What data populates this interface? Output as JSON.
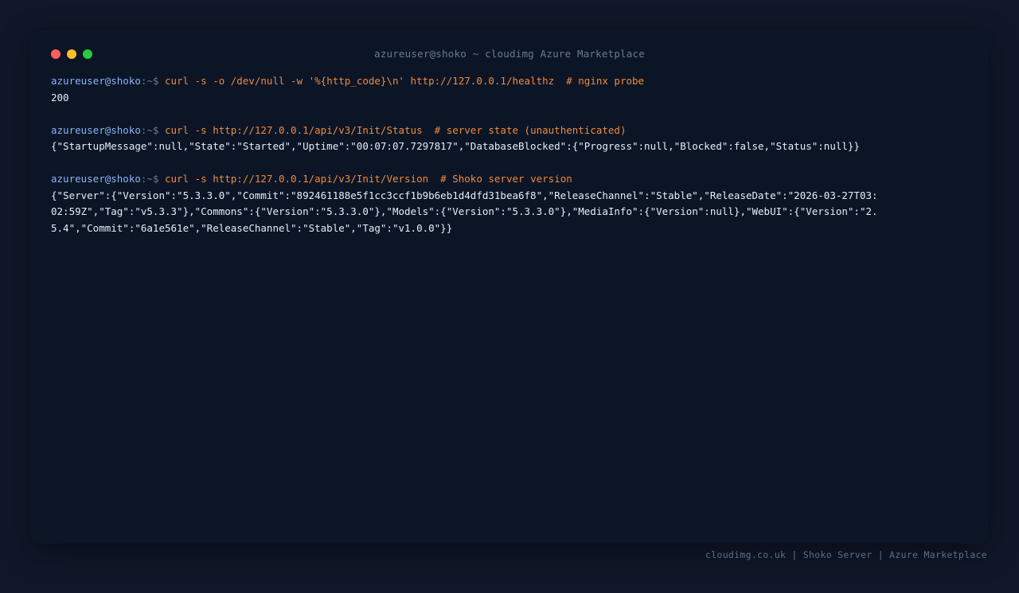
{
  "window": {
    "title": "azureuser@shoko ~ cloudimg Azure Marketplace"
  },
  "prompt": {
    "user": "azureuser@shoko",
    "path": ":~$ "
  },
  "blocks": [
    {
      "command": "curl -s -o /dev/null -w '%{http_code}\\n' http://127.0.0.1/healthz  # nginx probe",
      "output": "200"
    },
    {
      "command": "curl -s http://127.0.0.1/api/v3/Init/Status  # server state (unauthenticated)",
      "output": "{\"StartupMessage\":null,\"State\":\"Started\",\"Uptime\":\"00:07:07.7297817\",\"DatabaseBlocked\":{\"Progress\":null,\"Blocked\":false,\"Status\":null}}"
    },
    {
      "command": "curl -s http://127.0.0.1/api/v3/Init/Version  # Shoko server version",
      "output": "{\"Server\":{\"Version\":\"5.3.3.0\",\"Commit\":\"892461188e5f1cc3ccf1b9b6eb1d4dfd31bea6f8\",\"ReleaseChannel\":\"Stable\",\"ReleaseDate\":\"2026-03-27T03:02:59Z\",\"Tag\":\"v5.3.3\"},\"Commons\":{\"Version\":\"5.3.3.0\"},\"Models\":{\"Version\":\"5.3.3.0\"},\"MediaInfo\":{\"Version\":null},\"WebUI\":{\"Version\":\"2.5.4\",\"Commit\":\"6a1e561e\",\"ReleaseChannel\":\"Stable\",\"Tag\":\"v1.0.0\"}}"
    }
  ],
  "footer": {
    "text": "cloudimg.co.uk | Shoko Server | Azure Marketplace"
  },
  "colors": {
    "background": "#0f1729",
    "window": "#0b1526",
    "prompt_user": "#8ab4f8",
    "command": "#f28a3c",
    "output": "#e6edf6"
  }
}
